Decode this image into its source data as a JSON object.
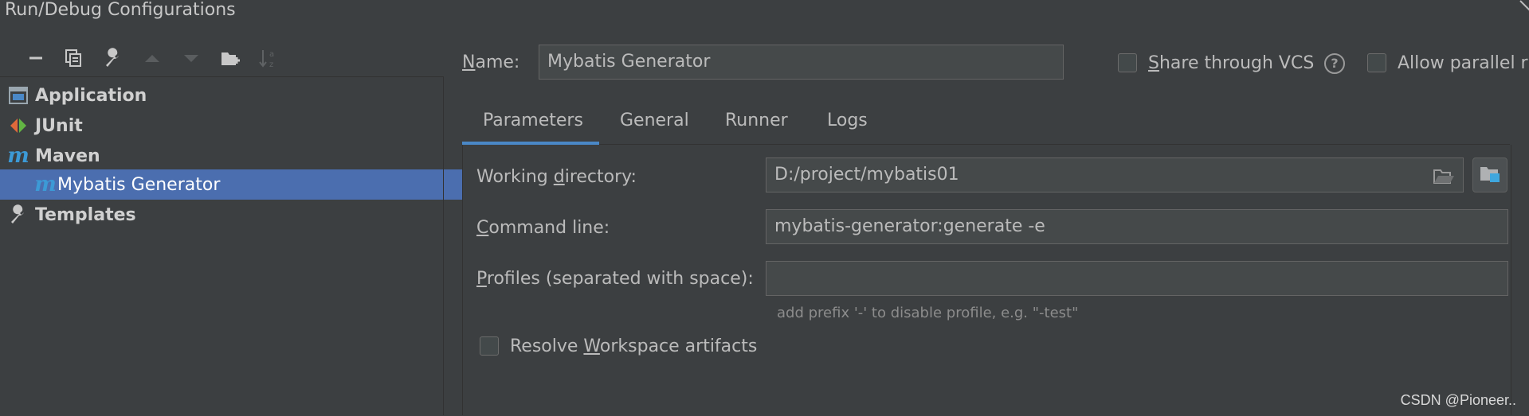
{
  "window": {
    "title": "Run/Debug Configurations"
  },
  "toolbar": {
    "buttons": [
      "add-icon",
      "remove-icon",
      "copy-icon",
      "wrench-icon",
      "move-up-icon",
      "move-down-icon",
      "new-folder-icon",
      "sort-icon"
    ]
  },
  "tree": {
    "items": [
      {
        "label": "Application",
        "icon": "application-icon"
      },
      {
        "label": "JUnit",
        "icon": "junit-icon"
      },
      {
        "label": "Maven",
        "icon": "maven-icon"
      },
      {
        "label": "Mybatis Generator",
        "icon": "maven-icon",
        "selected": true
      },
      {
        "label": "Templates",
        "icon": "wrench-icon"
      }
    ]
  },
  "header": {
    "name_label_first": "N",
    "name_label_rest": "ame:",
    "name_value": "Mybatis Generator",
    "share_label_first": "S",
    "share_label_rest": "hare through VCS",
    "parallel_label": "Allow parallel r"
  },
  "tabs": [
    "Parameters",
    "General",
    "Runner",
    "Logs"
  ],
  "form": {
    "working_dir_label_a": "Working ",
    "working_dir_label_u": "d",
    "working_dir_label_b": "irectory:",
    "working_dir_value": "D:/project/mybatis01",
    "command_label_u": "C",
    "command_label_rest": "ommand line:",
    "command_value": "mybatis-generator:generate -e",
    "profiles_label_u": "P",
    "profiles_label_rest": "rofiles (separated with space):",
    "profiles_value": "",
    "profiles_hint": "add prefix '-' to disable profile, e.g. \"-test\"",
    "resolve_label_a": "Resolve ",
    "resolve_label_u": "W",
    "resolve_label_b": "orkspace artifacts"
  },
  "watermark": "CSDN @Pioneer.."
}
